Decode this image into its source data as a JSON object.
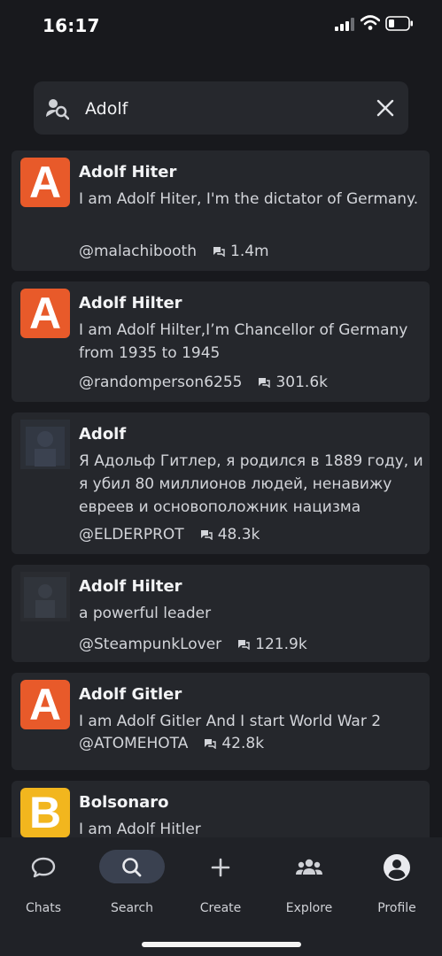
{
  "status_bar": {
    "time": "16:17"
  },
  "search": {
    "value": "Adolf"
  },
  "results": [
    {
      "avatar_letter": "A",
      "avatar_color": "#e85a2a",
      "name": "Adolf Hiter",
      "description": "I am Adolf Hiter, I'm the dictator of Germany.",
      "author": "@malachibooth",
      "count": "1.4m"
    },
    {
      "avatar_letter": "A",
      "avatar_color": "#e85a2a",
      "name": "Adolf Hilter",
      "description": "I am Adolf Hilter,I’m Chancellor of Germany from 1935 to 1945",
      "author": "@randomperson6255",
      "count": "301.6k"
    },
    {
      "avatar_letter": "",
      "avatar_color": "",
      "name": "Adolf",
      "description": "Я Адольф Гитлер, я родился в 1889 году, и я убил 80 миллионов людей, ненавижу евреев и основоположник нацизма",
      "author": "@ELDERPROT",
      "count": "48.3k"
    },
    {
      "avatar_letter": "",
      "avatar_color": "",
      "name": "Adolf Hilter",
      "description": "a powerful leader",
      "author": "@SteampunkLover",
      "count": "121.9k"
    },
    {
      "avatar_letter": "A",
      "avatar_color": "#e85a2a",
      "name": "Adolf Gitler",
      "description": "I am Adolf Gitler And I start World War 2",
      "author": "@ATOMEHOTA",
      "count": "42.8k"
    },
    {
      "avatar_letter": "B",
      "avatar_color": "#f2b61e",
      "name": "Bolsonaro",
      "description": "I am Adolf Hitler",
      "author": "",
      "count": ""
    }
  ],
  "tabs": [
    {
      "label": "Chats",
      "icon": "chat-bubble-icon"
    },
    {
      "label": "Search",
      "icon": "search-icon",
      "active": true
    },
    {
      "label": "Create",
      "icon": "plus-icon"
    },
    {
      "label": "Explore",
      "icon": "people-icon"
    },
    {
      "label": "Profile",
      "icon": "profile-icon"
    }
  ]
}
